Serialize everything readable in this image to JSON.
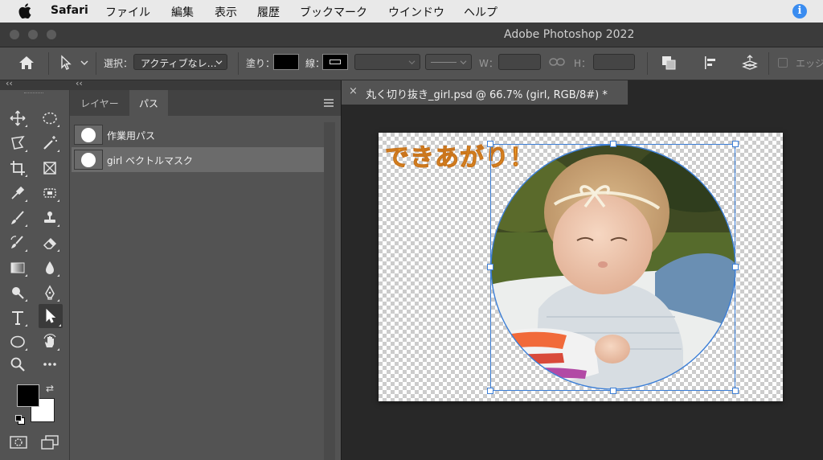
{
  "menubar": {
    "app": "Safari",
    "items": [
      "ファイル",
      "編集",
      "表示",
      "履歴",
      "ブックマーク",
      "ウインドウ",
      "ヘルプ"
    ]
  },
  "window": {
    "title": "Adobe Photoshop 2022"
  },
  "options": {
    "select_label": "選択：",
    "select_value": "アクティブなレ…",
    "fill_label": "塗り：",
    "stroke_label": "線：",
    "w_label": "W：",
    "h_label": "H：",
    "edge_label": "エッジ"
  },
  "panel": {
    "tabs": [
      "レイヤー",
      "パス"
    ],
    "active_tab": "パス",
    "paths": [
      "作業用パス",
      "girl ベクトルマスク"
    ]
  },
  "document": {
    "tab_title": "丸く切り抜き_girl.psd @ 66.7% (girl, RGB/8#) *",
    "headline": "できあがり！"
  },
  "colors": {
    "accent": "#3d7fd6",
    "headline": "#f5a623",
    "foreground": "#000000",
    "background": "#ffffff"
  }
}
